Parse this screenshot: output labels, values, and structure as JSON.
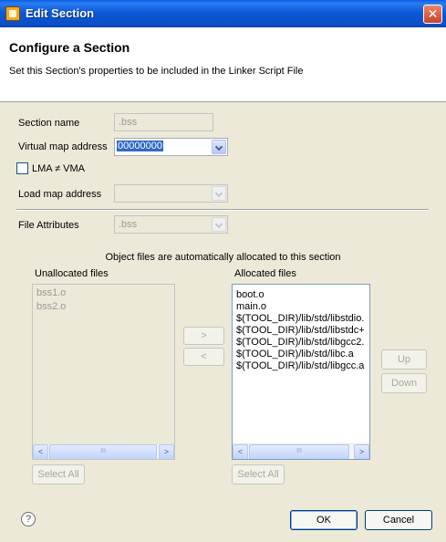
{
  "window": {
    "title": "Edit Section",
    "close_glyph": "✕"
  },
  "header": {
    "title": "Configure a Section",
    "description": "Set this Section's properties to be included in the Linker Script File"
  },
  "form": {
    "section_name_label": "Section name",
    "section_name_value": ".bss",
    "virtual_map_label": "Virtual map address",
    "virtual_map_value": "00000000",
    "lma_checkbox_label": "LMA ≠ VMA",
    "lma_checked": false,
    "load_map_label": "Load map address",
    "load_map_value": "",
    "file_attributes_label": "File Attributes",
    "file_attributes_value": ".bss"
  },
  "allocation": {
    "info_text": "Object files are automatically allocated to this section",
    "unallocated_label": "Unallocated files",
    "allocated_label": "Allocated files",
    "unallocated_files": [
      "bss1.o",
      "bss2.o"
    ],
    "allocated_files": [
      "boot.o",
      "main.o",
      "$(TOOL_DIR)/lib/std/libstdio.",
      "$(TOOL_DIR)/lib/std/libstdc+",
      "$(TOOL_DIR)/lib/std/libgcc2.",
      "$(TOOL_DIR)/lib/std/libc.a",
      "$(TOOL_DIR)/lib/std/libgcc.a"
    ],
    "move_right_label": ">",
    "move_left_label": "<",
    "up_label": "Up",
    "down_label": "Down",
    "select_all_label": "Select All",
    "scroll_thumb_grip": "III",
    "scroll_left_glyph": "<",
    "scroll_right_glyph": ">"
  },
  "footer": {
    "help_glyph": "?",
    "ok_label": "OK",
    "cancel_label": "Cancel"
  },
  "colors": {
    "title_bar": "#0a4fc8",
    "dialog_bg": "#ece9d8",
    "selection": "#316ac5"
  }
}
